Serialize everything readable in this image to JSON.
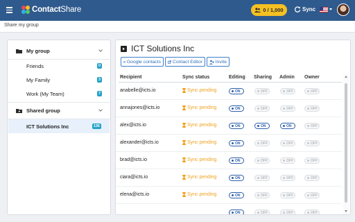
{
  "app": {
    "brand_bold": "Contact",
    "brand_light": "Share",
    "quota": "0 / 1,000",
    "sync_label": "Sync",
    "colors": {
      "topbar": "#2f5a8d",
      "quota": "#f5c022",
      "accent": "#2e6fbf",
      "pending": "#f0a21e",
      "badge": "#25a2c7"
    }
  },
  "breadcrumb": "Share my group",
  "sidebar": {
    "my_group": {
      "label": "My group",
      "items": [
        {
          "label": "Friends",
          "count": "0"
        },
        {
          "label": "My Family",
          "count": "3"
        },
        {
          "label": "Work (My Team)",
          "count": "7"
        }
      ]
    },
    "shared_group": {
      "label": "Shared group",
      "items": [
        {
          "label": "ICT Solutions Inc",
          "count": "136"
        }
      ]
    }
  },
  "main": {
    "title": "ICT Solutions Inc",
    "buttons": {
      "google": "Google contacts",
      "editor": "Contact Editor",
      "invite": "Invite"
    },
    "columns": {
      "recipient": "Recipient",
      "sync_status": "Sync status",
      "editing": "Editing",
      "sharing": "Sharing",
      "admin": "Admin",
      "owner": "Owner"
    },
    "on_label": "ON",
    "off_label": "OFF",
    "rows": [
      {
        "email": "anabelle@icts.io",
        "status": "Sync pending",
        "editing": true,
        "sharing": false,
        "admin": false,
        "owner": false
      },
      {
        "email": "annajones@icts.io",
        "status": "Sync pending",
        "editing": true,
        "sharing": false,
        "admin": false,
        "owner": false
      },
      {
        "email": "alex@icts.io",
        "status": "Sync pending",
        "editing": true,
        "sharing": true,
        "admin": true,
        "owner": false
      },
      {
        "email": "alexander@icts.io",
        "status": "Sync pending",
        "editing": true,
        "sharing": false,
        "admin": false,
        "owner": false
      },
      {
        "email": "brad@icts.io",
        "status": "Sync pending",
        "editing": true,
        "sharing": false,
        "admin": false,
        "owner": false
      },
      {
        "email": "ciara@icts.io",
        "status": "Sync pending",
        "editing": true,
        "sharing": false,
        "admin": false,
        "owner": false
      },
      {
        "email": "elena@icts.io",
        "status": "Sync pending",
        "editing": true,
        "sharing": false,
        "admin": false,
        "owner": false
      },
      {
        "email": "",
        "status": "",
        "editing": true,
        "sharing": false,
        "admin": false,
        "owner": false
      }
    ]
  }
}
